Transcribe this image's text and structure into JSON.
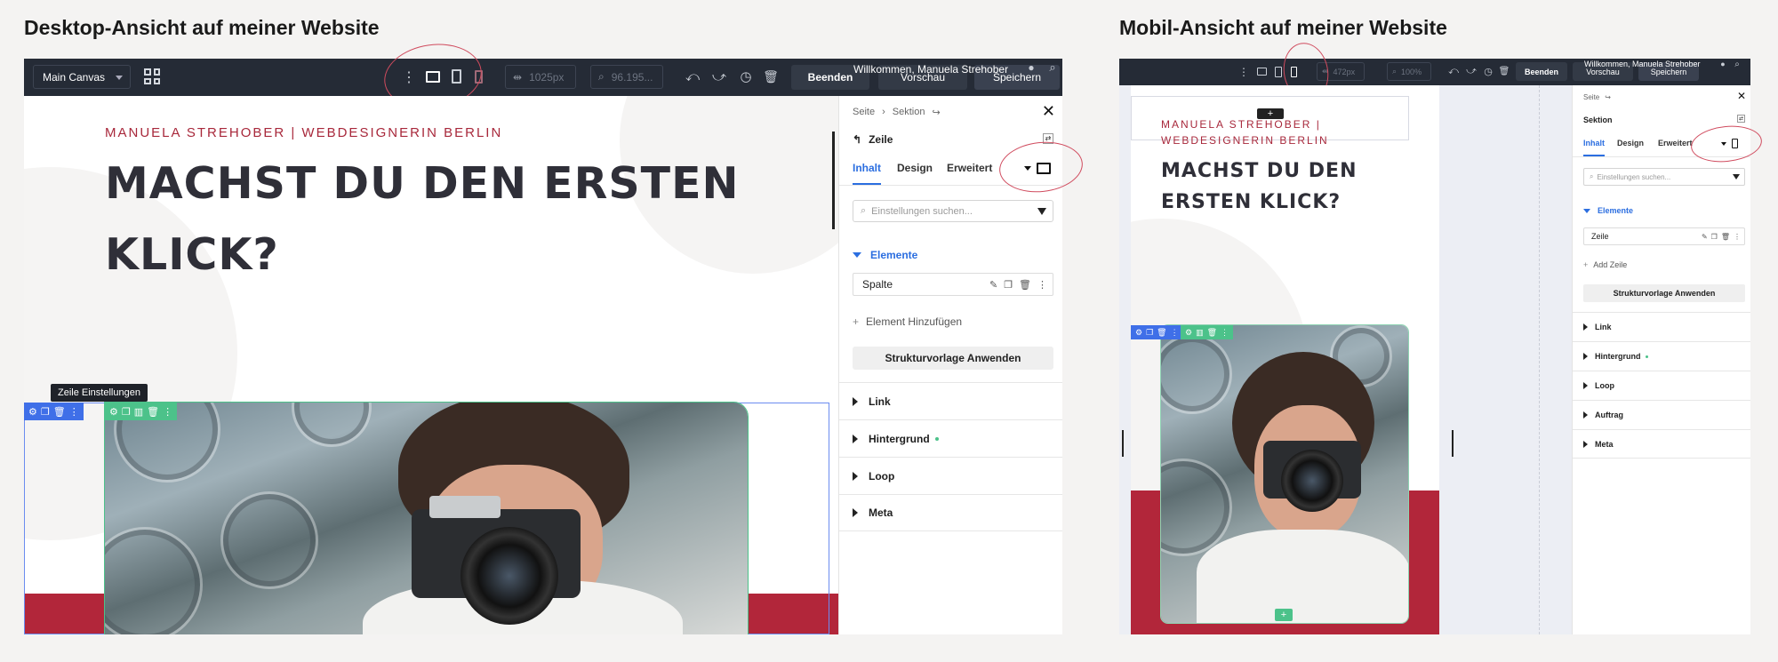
{
  "headings": {
    "desktop": "Desktop-Ansicht auf meiner Website",
    "mobile": "Mobil-Ansicht auf meiner Website"
  },
  "toolbar": {
    "canvas_select": "Main Canvas",
    "width_desktop": "1025px",
    "zoom_desktop": "96.195...",
    "width_mobile": "472px",
    "zoom_mobile": "100%",
    "beenden": "Beenden",
    "vorschau": "Vorschau",
    "speichern": "Speichern",
    "welcome": "Willkommen, Manuela Strehober"
  },
  "desktop_canvas": {
    "eyebrow": "MANUELA STREHOBER | WEBDESIGNERIN BERLIN",
    "title_line1": "MACHST DU DEN ERSTEN",
    "title_line2": "KLICK?",
    "tooltip": "Zeile Einstellungen"
  },
  "desktop_panel": {
    "breadcrumb_1": "Seite",
    "breadcrumb_2": "Sektion",
    "element_title": "Zeile",
    "tabs": [
      "Inhalt",
      "Design",
      "Erweitert"
    ],
    "search_placeholder": "Einstellungen suchen...",
    "section_elemente": "Elemente",
    "item": "Spalte",
    "add_element": "Element Hinzufügen",
    "apply_template": "Strukturvorlage Anwenden",
    "sections": [
      "Link",
      "Hintergrund",
      "Loop",
      "Meta"
    ]
  },
  "mobile_canvas": {
    "eyebrow_line1": "MANUELA STREHOBER |",
    "eyebrow_line2": "WEBDESIGNERIN BERLIN",
    "title_line1": "MACHST DU DEN",
    "title_line2": "ERSTEN KLICK?"
  },
  "mobile_panel": {
    "breadcrumb_1": "Seite",
    "element_title": "Sektion",
    "tabs": [
      "Inhalt",
      "Design",
      "Erweitert"
    ],
    "search_placeholder": "Einstellungen suchen...",
    "section_elemente": "Elemente",
    "item": "Zeile",
    "add_row": "Add Zeile",
    "apply_template": "Strukturvorlage Anwenden",
    "sections": [
      "Link",
      "Hintergrund",
      "Loop",
      "Auftrag",
      "Meta"
    ]
  },
  "colors": {
    "toolbar_bg": "#252b36",
    "accent_blue": "#2b6ee0",
    "brand_red": "#b2263a",
    "handle_green": "#4cc28a",
    "handle_blue": "#3f6fe8",
    "annotation": "#d04b5e"
  }
}
